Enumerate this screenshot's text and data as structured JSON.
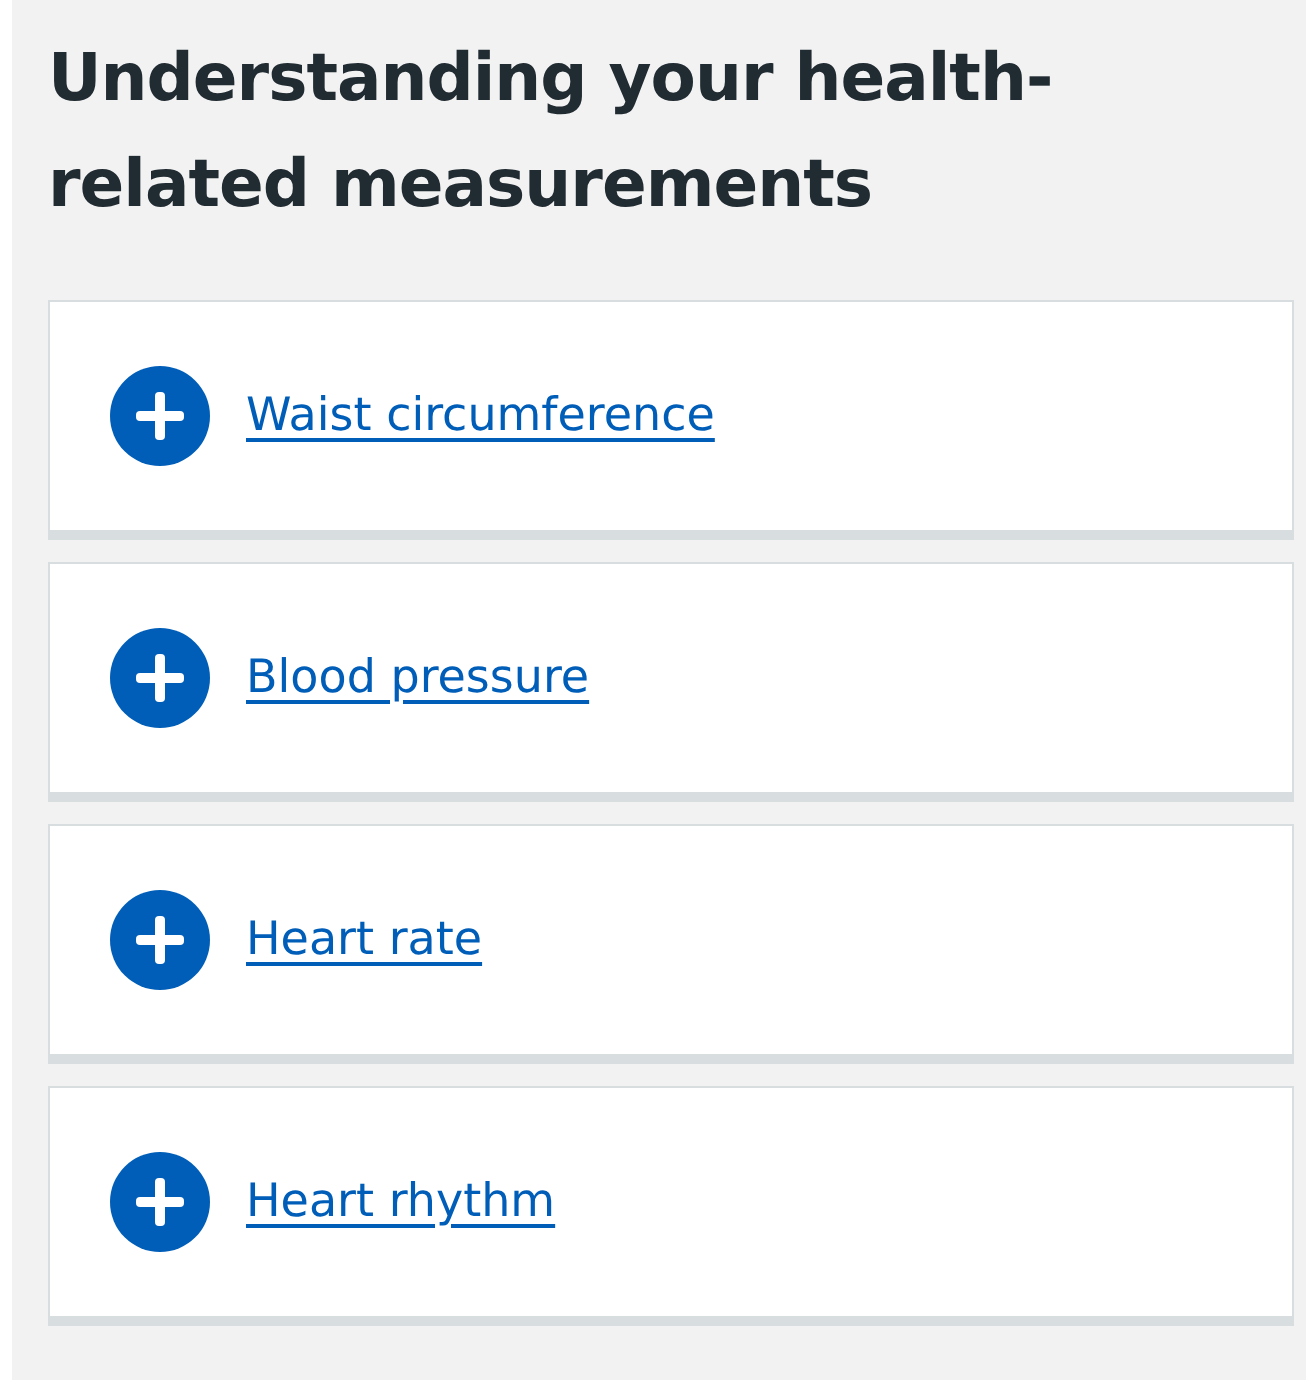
{
  "heading": "Understanding your health-related measurements",
  "items": [
    {
      "label": "Waist circumference",
      "expanded": false
    },
    {
      "label": "Blood pressure",
      "expanded": false
    },
    {
      "label": "Heart rate",
      "expanded": false
    },
    {
      "label": "Heart rhythm",
      "expanded": false
    }
  ]
}
